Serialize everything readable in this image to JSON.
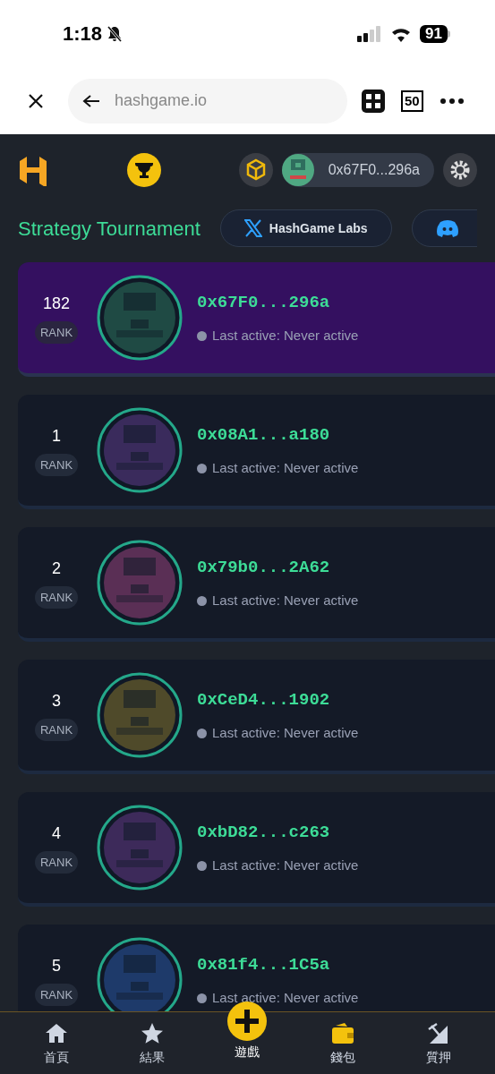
{
  "status_bar": {
    "time": "1:18",
    "battery": "91"
  },
  "browser": {
    "url": "hashgame.io",
    "tab_count": "50"
  },
  "header": {
    "wallet": "0x67F0...296a"
  },
  "title": "Strategy Tournament",
  "social_links": [
    {
      "kind": "x",
      "label": "HashGame Labs"
    },
    {
      "kind": "discord"
    }
  ],
  "players": [
    {
      "rank": "182",
      "rank_label": "RANK",
      "address": "0x67F0...296a",
      "last_active": "Last active: Never active",
      "current_user": true,
      "color": "#1f4a44"
    },
    {
      "rank": "1",
      "rank_label": "RANK",
      "address": "0x08A1...a180",
      "last_active": "Last active: Never active",
      "current_user": false,
      "color": "#3a2b5c"
    },
    {
      "rank": "2",
      "rank_label": "RANK",
      "address": "0x79b0...2A62",
      "last_active": "Last active: Never active",
      "current_user": false,
      "color": "#5a2f55"
    },
    {
      "rank": "3",
      "rank_label": "RANK",
      "address": "0xCeD4...1902",
      "last_active": "Last active: Never active",
      "current_user": false,
      "color": "#4f4a2a"
    },
    {
      "rank": "4",
      "rank_label": "RANK",
      "address": "0xbD82...c263",
      "last_active": "Last active: Never active",
      "current_user": false,
      "color": "#3d2a5a"
    },
    {
      "rank": "5",
      "rank_label": "RANK",
      "address": "0x81f4...1C5a",
      "last_active": "Last active: Never active",
      "current_user": false,
      "color": "#1e3a6a"
    }
  ],
  "nav": [
    {
      "kind": "home",
      "label": "首頁",
      "selected": false
    },
    {
      "kind": "star",
      "label": "結果",
      "selected": false
    },
    {
      "kind": "game",
      "label": "遊戲",
      "selected": true
    },
    {
      "kind": "wallet",
      "label": "錢包",
      "selected": false
    },
    {
      "kind": "stake",
      "label": "質押",
      "selected": false
    }
  ]
}
